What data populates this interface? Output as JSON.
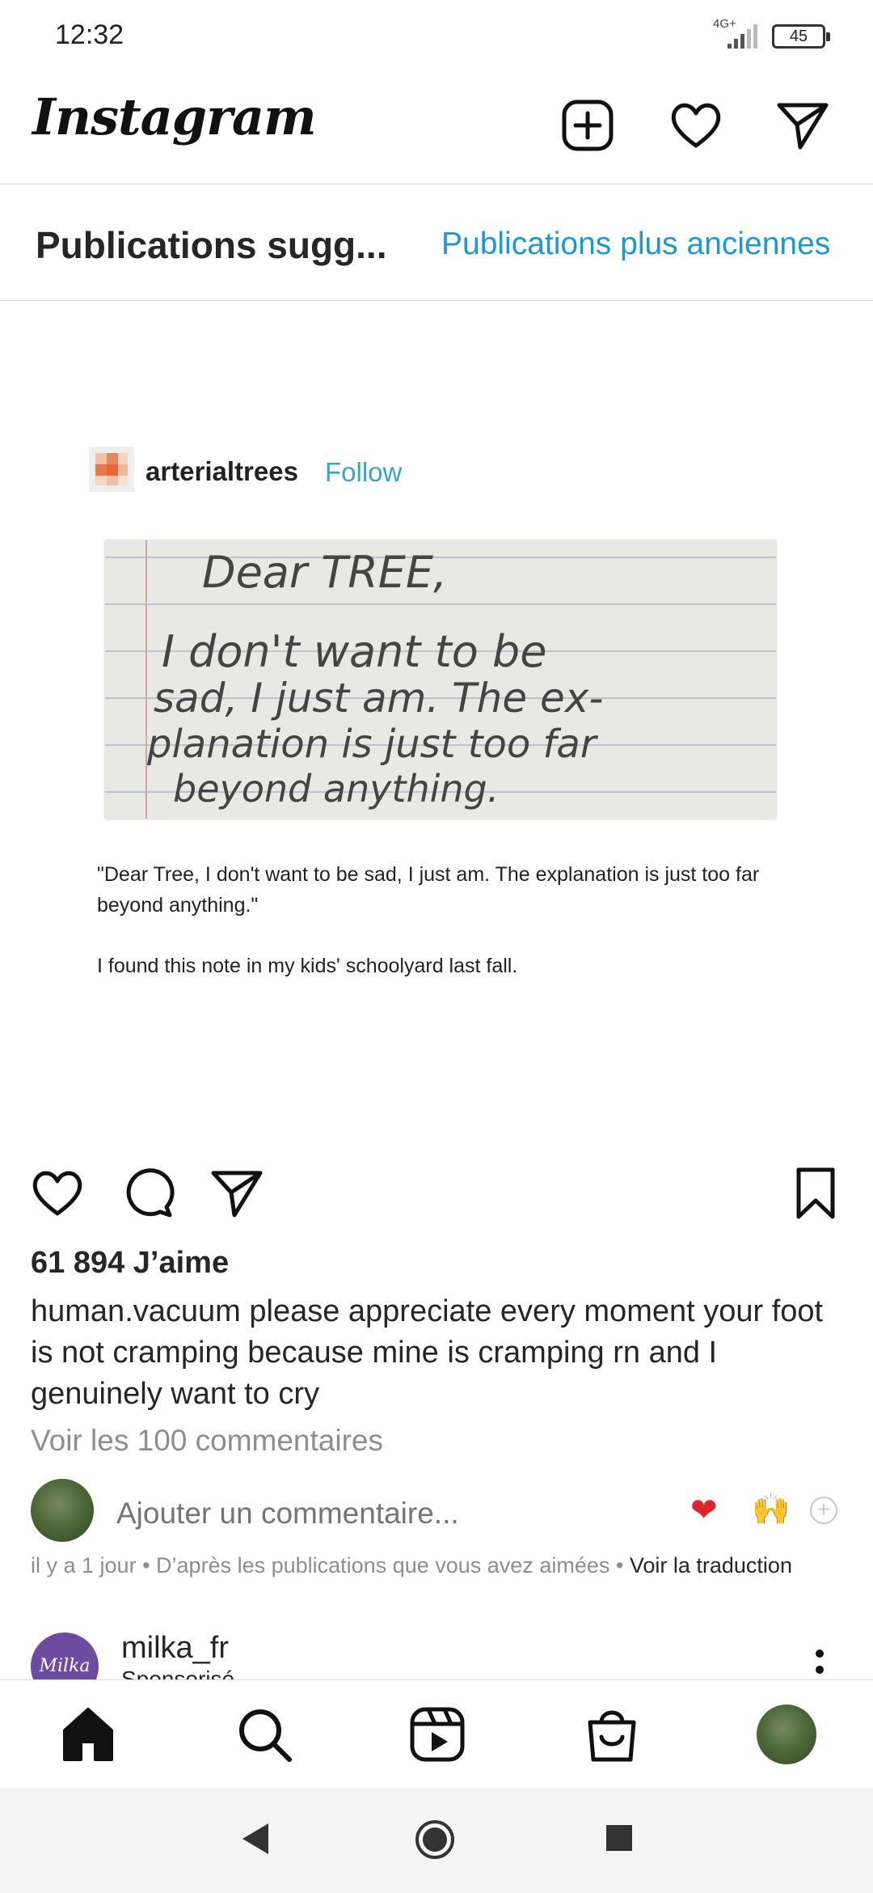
{
  "status_bar": {
    "time": "12:32",
    "network": "4G+",
    "battery": "45"
  },
  "header": {
    "logo": "Instagram",
    "icons": [
      "new-post-icon",
      "heart-icon",
      "direct-message-icon"
    ]
  },
  "suggested": {
    "title": "Publications sugg...",
    "older_link": "Publications plus anciennes"
  },
  "post_image": {
    "tumblr_user": "arterialtrees",
    "tumblr_follow": "Follow",
    "note_lines": [
      "Dear TREE,",
      "I don't want to be",
      "sad, I just am. The ex-",
      "planation is just too far",
      "beyond anything."
    ],
    "caption_quote": "\"Dear Tree, I don't want to be sad, I just am. The explanation is just too far beyond anything.\"",
    "caption_found": "I found this note in my kids' schoolyard last fall."
  },
  "post": {
    "likes": "61 894 J’aime",
    "caption_user": "human.vacuum",
    "caption_text": " please appreciate every moment your foot is not cramping because mine is cramping rn and I genuinely want to cry",
    "view_comments": "Voir les 100 commentaires",
    "comment_placeholder": "Ajouter un commentaire...",
    "quick_emojis": [
      "❤",
      "🙌"
    ],
    "meta_time": "il y a 1 jour",
    "meta_reason": "D’après les publications que vous avez aimées",
    "meta_translate": "Voir la traduction"
  },
  "next_post": {
    "avatar_text": "Milka",
    "username": "milka_fr",
    "subtitle": "Sponsorisé"
  },
  "colors": {
    "link_blue": "#1a98d8",
    "heart_red": "#e0242b",
    "muted": "#8e8e8e"
  }
}
